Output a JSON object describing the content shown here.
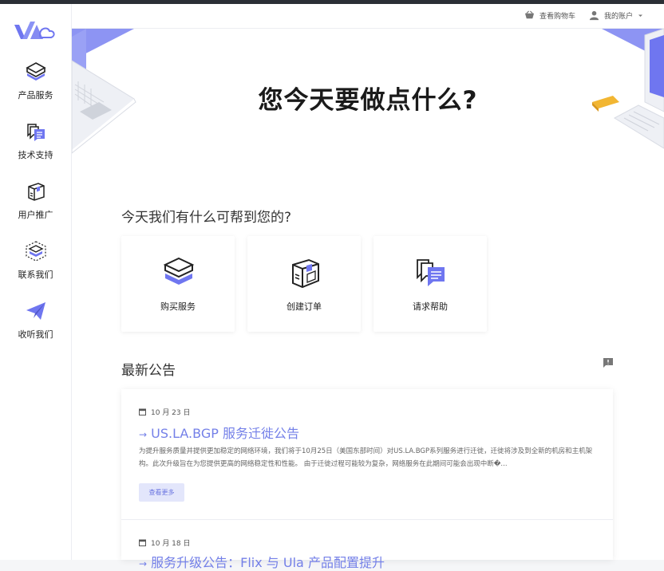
{
  "header": {
    "cart_label": "查看购物车",
    "account_label": "我的账户"
  },
  "sidebar": {
    "items": [
      {
        "label": "产品服务",
        "icon": "box-icon"
      },
      {
        "label": "技术支持",
        "icon": "chat-bubbles-icon"
      },
      {
        "label": "用户推广",
        "icon": "package-icon"
      },
      {
        "label": "联系我们",
        "icon": "layers-icon"
      },
      {
        "label": "收听我们",
        "icon": "paper-plane-icon"
      }
    ]
  },
  "hero": {
    "title": "您今天要做点什么?"
  },
  "help": {
    "title": "今天我们有什么可帮到您的?",
    "cards": [
      {
        "label": "购买服务",
        "icon": "box-icon"
      },
      {
        "label": "创建订单",
        "icon": "package-icon"
      },
      {
        "label": "请求帮助",
        "icon": "chat-bubbles-icon"
      }
    ]
  },
  "announcements": {
    "title": "最新公告",
    "items": [
      {
        "date": "10 月 23 日",
        "title": "US.LA.BGP 服务迁徙公告",
        "body": "为提升服务质量并提供更加稳定的网络环境，我们将于10月25日（美国东部时间）对US.LA.BGP系列服务进行迁徙，迁徙将涉及到全新的机房和主机架构。此次升级旨在为您提供更高的网络稳定性和性能。 由于迁徙过程可能较为复杂，网络服务在此期间可能会出现中断�...",
        "button": "查看更多"
      },
      {
        "date": "10 月 18 日",
        "title": "服务升级公告：Flix 与 Ula 产品配置提升"
      }
    ]
  },
  "colors": {
    "accent": "#7480e8",
    "button_bg": "#e3e6fb",
    "icon_purple": "#6f76f0",
    "page_bg": "#f5f6f8"
  }
}
